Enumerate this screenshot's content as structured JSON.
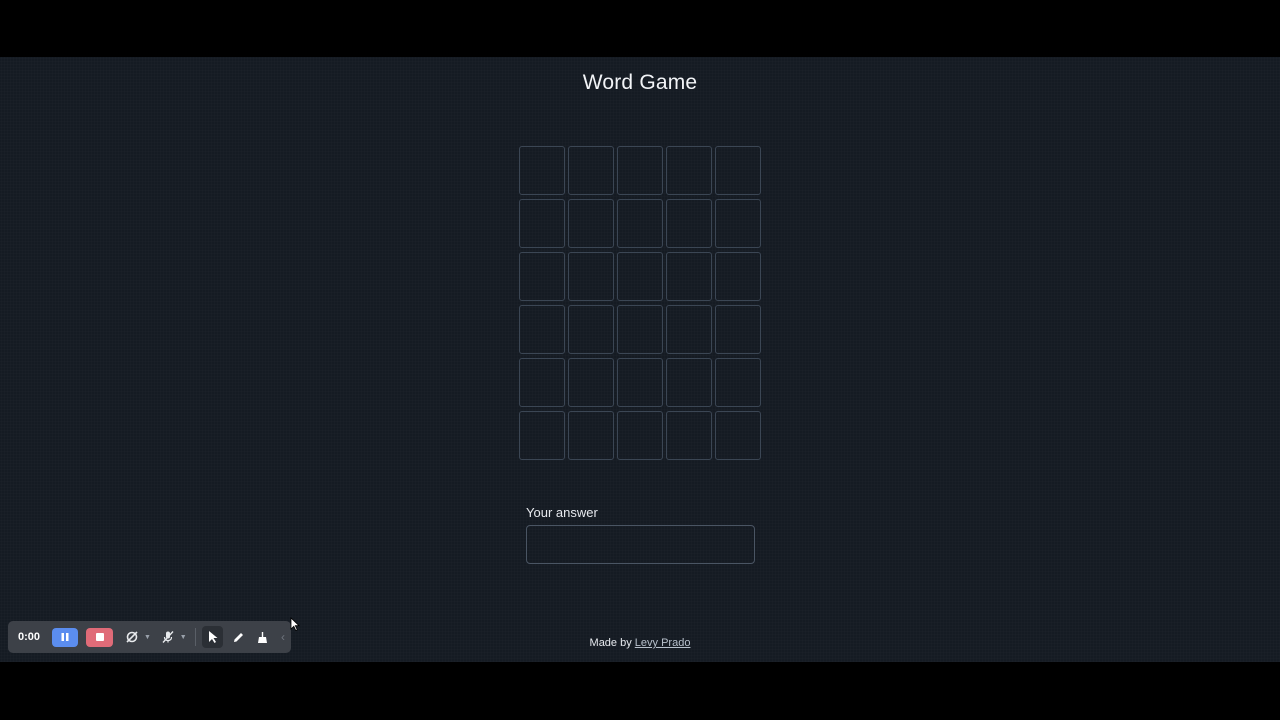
{
  "app": {
    "title": "Word Game"
  },
  "board": {
    "rows": 6,
    "cols": 5,
    "tiles": [
      [
        "",
        "",
        "",
        "",
        ""
      ],
      [
        "",
        "",
        "",
        "",
        ""
      ],
      [
        "",
        "",
        "",
        "",
        ""
      ],
      [
        "",
        "",
        "",
        "",
        ""
      ],
      [
        "",
        "",
        "",
        "",
        ""
      ],
      [
        "",
        "",
        "",
        "",
        ""
      ]
    ]
  },
  "answer": {
    "label": "Your answer",
    "value": "",
    "placeholder": ""
  },
  "footer": {
    "prefix": "Made by",
    "author_link": "Levy Prado"
  },
  "recorder_toolbar": {
    "timer": "0:00",
    "icons": [
      "pause-icon",
      "stop-icon",
      "camera-off-icon",
      "mic-off-icon",
      "pointer-icon",
      "pen-icon",
      "broom-icon",
      "chevron-left-icon"
    ]
  },
  "colors": {
    "background": "#151b23",
    "tile_border": "#3b4654",
    "text": "#f2f4f7",
    "pause_button": "#5b8def",
    "stop_button": "#e06b78",
    "toolbar": "#3d4148"
  }
}
